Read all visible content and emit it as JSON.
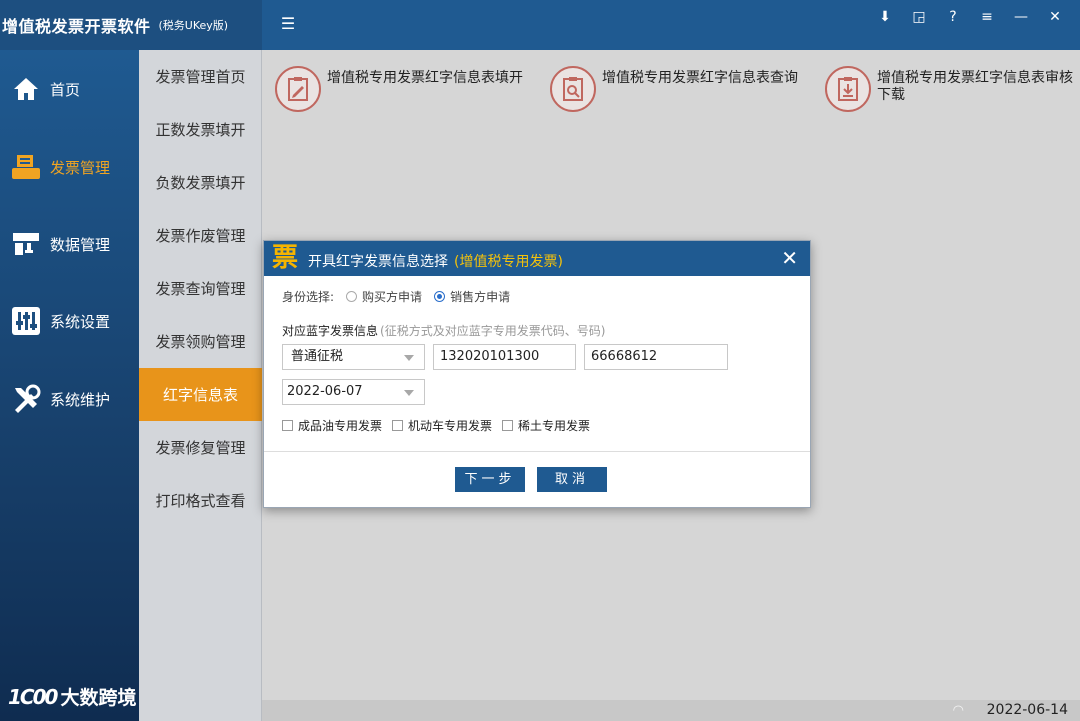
{
  "app": {
    "title": "增值税发票开票软件",
    "subtitle": "(税务UKey版)"
  },
  "window_controls": [
    "download-icon",
    "restore-icon",
    "help-icon",
    "menu-icon",
    "minimize-icon",
    "close-icon"
  ],
  "primary_nav": [
    {
      "label": "首页",
      "icon": "home-icon",
      "active": false
    },
    {
      "label": "发票管理",
      "icon": "invoice-printer-icon",
      "active": true
    },
    {
      "label": "数据管理",
      "icon": "data-icon",
      "active": false
    },
    {
      "label": "系统设置",
      "icon": "settings-sliders-icon",
      "active": false
    },
    {
      "label": "系统维护",
      "icon": "tools-icon",
      "active": false
    }
  ],
  "secondary_nav": [
    {
      "label": "发票管理首页",
      "active": false
    },
    {
      "label": "正数发票填开",
      "active": false
    },
    {
      "label": "负数发票填开",
      "active": false
    },
    {
      "label": "发票作废管理",
      "active": false
    },
    {
      "label": "发票查询管理",
      "active": false
    },
    {
      "label": "发票领购管理",
      "active": false
    },
    {
      "label": "红字信息表",
      "active": true
    },
    {
      "label": "发票修复管理",
      "active": false
    },
    {
      "label": "打印格式查看",
      "active": false
    }
  ],
  "functions": [
    {
      "label": "增值税专用发票红字信息表填开",
      "icon": "form-edit-icon"
    },
    {
      "label": "增值税专用发票红字信息表查询",
      "icon": "form-search-icon"
    },
    {
      "label": "增值税专用发票红字信息表审核下载",
      "icon": "form-download-icon"
    }
  ],
  "dialog": {
    "logo_char": "票",
    "title": "开具红字发票信息选择",
    "title_highlight": "(增值税专用发票)",
    "identity_label": "身份选择:",
    "identity_options": [
      {
        "label": "购买方申请",
        "checked": false
      },
      {
        "label": "销售方申请",
        "checked": true
      }
    ],
    "blue_label": "对应蓝字发票信息",
    "blue_hint": "(征税方式及对应蓝字专用发票代码、号码)",
    "tax_method": "普通征税",
    "invoice_code": "132020101300",
    "invoice_number": "66668612",
    "date": "2022-06-07",
    "checkboxes": [
      {
        "label": "成品油专用发票",
        "checked": false
      },
      {
        "label": "机动车专用发票",
        "checked": false
      },
      {
        "label": "稀土专用发票",
        "checked": false
      }
    ],
    "next_label": "下一步",
    "cancel_label": "取消"
  },
  "status": {
    "date": "2022-06-14"
  },
  "bottom_logo": {
    "mark": "1C00",
    "text": "大数跨境"
  },
  "colors": {
    "header": "#1f5a91",
    "active_orange": "#e8941a",
    "title_highlight": "#f5c20a"
  }
}
